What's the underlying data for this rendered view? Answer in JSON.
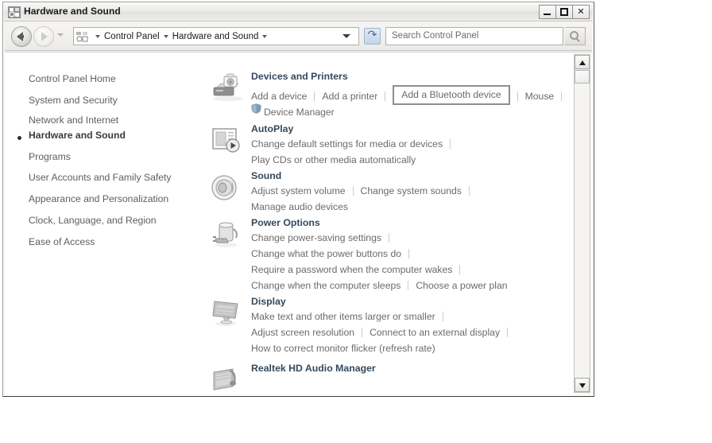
{
  "window": {
    "title": "Hardware and Sound",
    "title_icon": "control-panel-hardware-icon",
    "buttons": {
      "minimize": "Minimize",
      "maximize": "Maximize",
      "close": "Close"
    }
  },
  "addressbar": {
    "back_label": "Back",
    "forward_label": "Forward",
    "history_label": "Recent pages",
    "breadcrumb_icon": "control-panel-icon",
    "breadcrumb": [
      "Control Panel",
      "Hardware and Sound"
    ],
    "dropdown_label": "Previous locations",
    "refresh_label": "Refresh",
    "search_placeholder": "Search Control Panel",
    "search_value": "",
    "search_icon": "magnifier-icon"
  },
  "navpane": {
    "home": "Control Panel Home",
    "items": [
      {
        "label": "System and Security",
        "current": false
      },
      {
        "label": "Network and Internet",
        "current": false
      },
      {
        "label": "Hardware and Sound",
        "current": true
      },
      {
        "label": "Programs",
        "current": false
      },
      {
        "label": "User Accounts and Family Safety",
        "current": false
      },
      {
        "label": "Appearance and Personalization",
        "current": false
      },
      {
        "label": "Clock, Language, and Region",
        "current": false
      },
      {
        "label": "Ease of Access",
        "current": false
      }
    ]
  },
  "categories": [
    {
      "title": "Devices and Printers",
      "icon": "printer-camera-icon",
      "rows": [
        [
          {
            "label": "Add a device",
            "style": "plain"
          },
          {
            "label": "Add a printer",
            "style": "plain"
          },
          {
            "label": "Add a Bluetooth device",
            "style": "highlighted"
          },
          {
            "label": "Mouse",
            "style": "plain"
          }
        ],
        [
          {
            "label": "Device Manager",
            "style": "shield"
          }
        ]
      ]
    },
    {
      "title": "AutoPlay",
      "icon": "autoplay-icon",
      "rows": [
        [
          {
            "label": "Change default settings for media or devices",
            "style": "plain"
          }
        ],
        [
          {
            "label": "Play CDs or other media automatically",
            "style": "noseparator"
          }
        ]
      ]
    },
    {
      "title": "Sound",
      "icon": "speaker-icon",
      "rows": [
        [
          {
            "label": "Adjust system volume",
            "style": "plain"
          },
          {
            "label": "Change system sounds",
            "style": "plain"
          }
        ],
        [
          {
            "label": "Manage audio devices",
            "style": "noseparator"
          }
        ]
      ]
    },
    {
      "title": "Power Options",
      "icon": "power-plug-icon",
      "rows": [
        [
          {
            "label": "Change power-saving settings",
            "style": "plain"
          }
        ],
        [
          {
            "label": "Change what the power buttons do",
            "style": "plain"
          }
        ],
        [
          {
            "label": "Require a password when the computer wakes",
            "style": "plain"
          }
        ],
        [
          {
            "label": "Change when the computer sleeps",
            "style": "plain"
          },
          {
            "label": "Choose a power plan",
            "style": "noseparator"
          }
        ]
      ]
    },
    {
      "title": "Display",
      "icon": "monitor-icon",
      "rows": [
        [
          {
            "label": "Make text and other items larger or smaller",
            "style": "plain"
          }
        ],
        [
          {
            "label": "Adjust screen resolution",
            "style": "plain"
          },
          {
            "label": "Connect to an external display",
            "style": "plain"
          }
        ],
        [
          {
            "label": "How to correct monitor flicker (refresh rate)",
            "style": "noseparator"
          }
        ]
      ]
    },
    {
      "title": "Realtek HD Audio Manager",
      "icon": "realtek-audio-icon",
      "rows": []
    }
  ],
  "scrollbar": {
    "up_label": "Scroll up",
    "down_label": "Scroll down",
    "thumb_label": "Scroll thumb"
  },
  "colors": {
    "category_title": "#34495c",
    "link": "#6b6b6b",
    "nav_link": "#5e5e5e",
    "highlight_border": "#8e8e8e"
  }
}
